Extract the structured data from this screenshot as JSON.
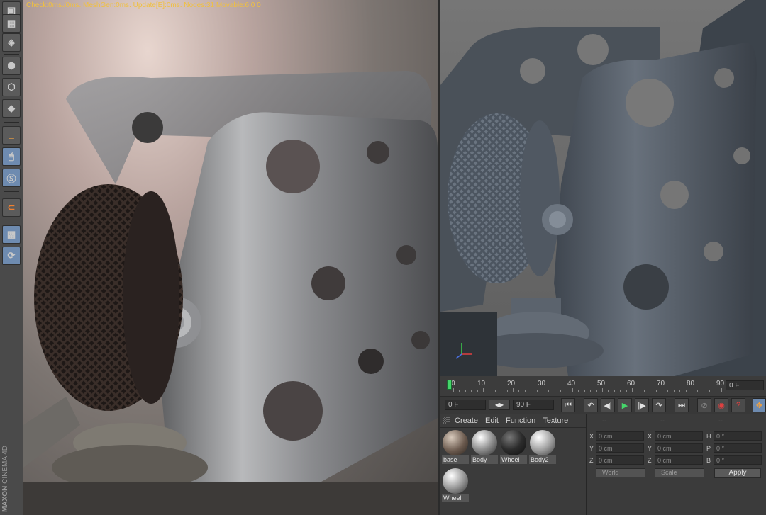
{
  "render": {
    "stats": "Check:0ms./0ms. MeshGen:0ms. Update[E]:0ms. Nodes:31 Movable:6  0 0"
  },
  "brand": {
    "maker": "MAXON",
    "product": "CINEMA 4D"
  },
  "toolbar": {
    "tools": [
      "cube-icon",
      "checker-cube-icon",
      "plane-icon",
      "model-cube-icon",
      "object-cube-icon",
      "polygon-cube-icon",
      "axis-icon",
      "mouse-icon",
      "snap-s-icon",
      "magnet-icon",
      "lock-grid-icon",
      "workplane-icon"
    ]
  },
  "timeline": {
    "ticks": [
      "0",
      "10",
      "20",
      "30",
      "40",
      "50",
      "60",
      "70",
      "80",
      "90"
    ],
    "current_frame": "0 F"
  },
  "transport": {
    "start_frame": "0 F",
    "end_frame": "90 F",
    "buttons": [
      "⏮",
      "↶",
      "◀|",
      "▶",
      "|▶",
      "↷",
      "⏭"
    ]
  },
  "materials": {
    "menu": [
      "Create",
      "Edit",
      "Function",
      "Texture"
    ],
    "items": [
      {
        "label": "base",
        "color": "#6b5a4e"
      },
      {
        "label": "Body",
        "color": "#8e8e8e"
      },
      {
        "label": "Wheel",
        "color": "#2c2c2c"
      },
      {
        "label": "Body2",
        "color": "#a3a3a3"
      },
      {
        "label": "Wheel",
        "color": "#9a9a9a"
      }
    ]
  },
  "coords": {
    "header": [
      "--",
      "--",
      "--"
    ],
    "rows": [
      {
        "a1": "X",
        "v1": "0 cm",
        "a2": "X",
        "v2": "0 cm",
        "a3": "H",
        "v3": "0 °"
      },
      {
        "a1": "Y",
        "v1": "0 cm",
        "a2": "Y",
        "v2": "0 cm",
        "a3": "P",
        "v3": "0 °"
      },
      {
        "a1": "Z",
        "v1": "0 cm",
        "a2": "Z",
        "v2": "0 cm",
        "a3": "B",
        "v3": "0 °"
      }
    ],
    "space": "World",
    "mode": "Scale",
    "apply": "Apply"
  }
}
